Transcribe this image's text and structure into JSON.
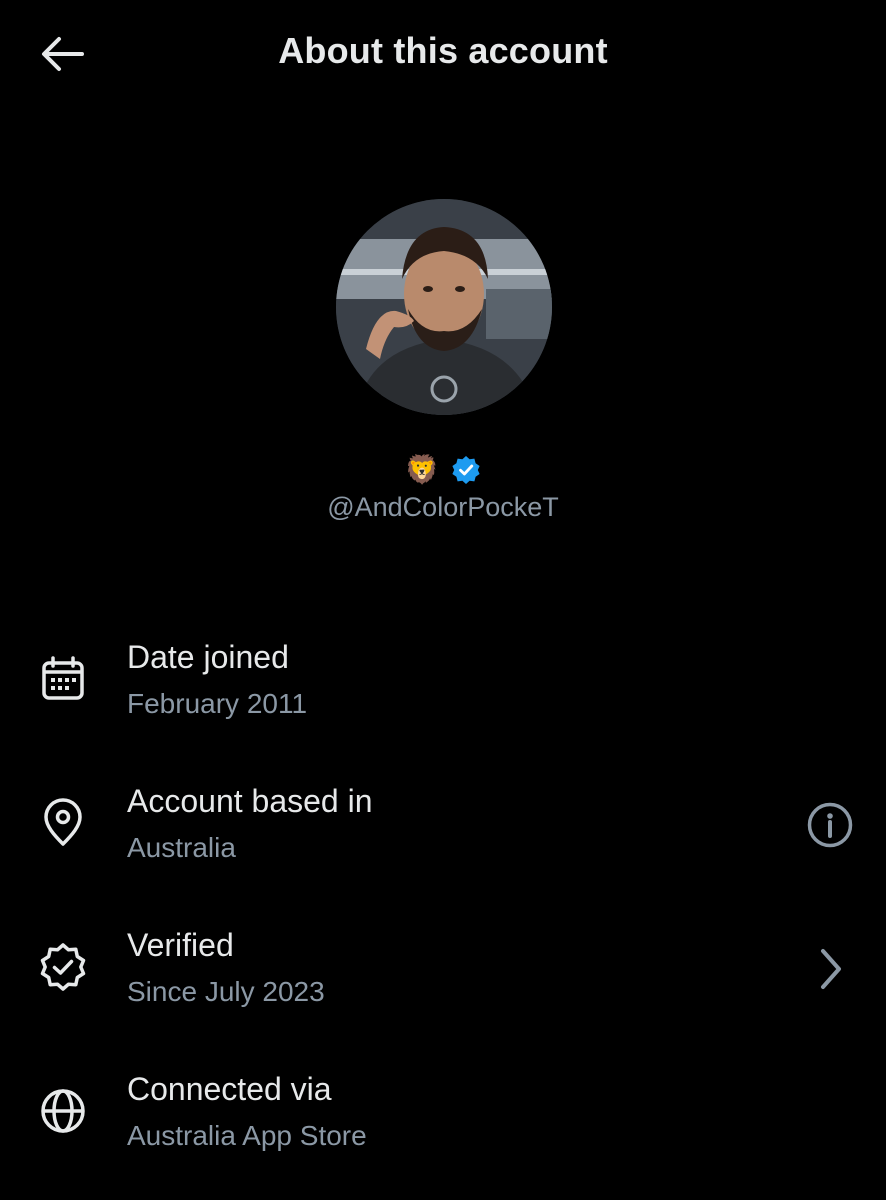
{
  "header": {
    "title": "About this account",
    "back_icon": "arrow-left-icon"
  },
  "profile": {
    "emoji": "🦁",
    "handle": "@AndColorPockeT",
    "verified_color": "#1d9bf0"
  },
  "rows": [
    {
      "icon": "calendar-icon",
      "title": "Date joined",
      "subtitle": "February 2011"
    },
    {
      "icon": "location-pin-icon",
      "title": "Account based in",
      "subtitle": "Australia",
      "action_icon": "info-icon"
    },
    {
      "icon": "verified-seal-icon",
      "title": "Verified",
      "subtitle": "Since July 2023",
      "action_icon": "chevron-right-icon"
    },
    {
      "icon": "globe-icon",
      "title": "Connected via",
      "subtitle": "Australia App Store"
    }
  ],
  "colors": {
    "background": "#000000",
    "primary_text": "#e7e9ea",
    "secondary_text": "#8b98a5"
  }
}
